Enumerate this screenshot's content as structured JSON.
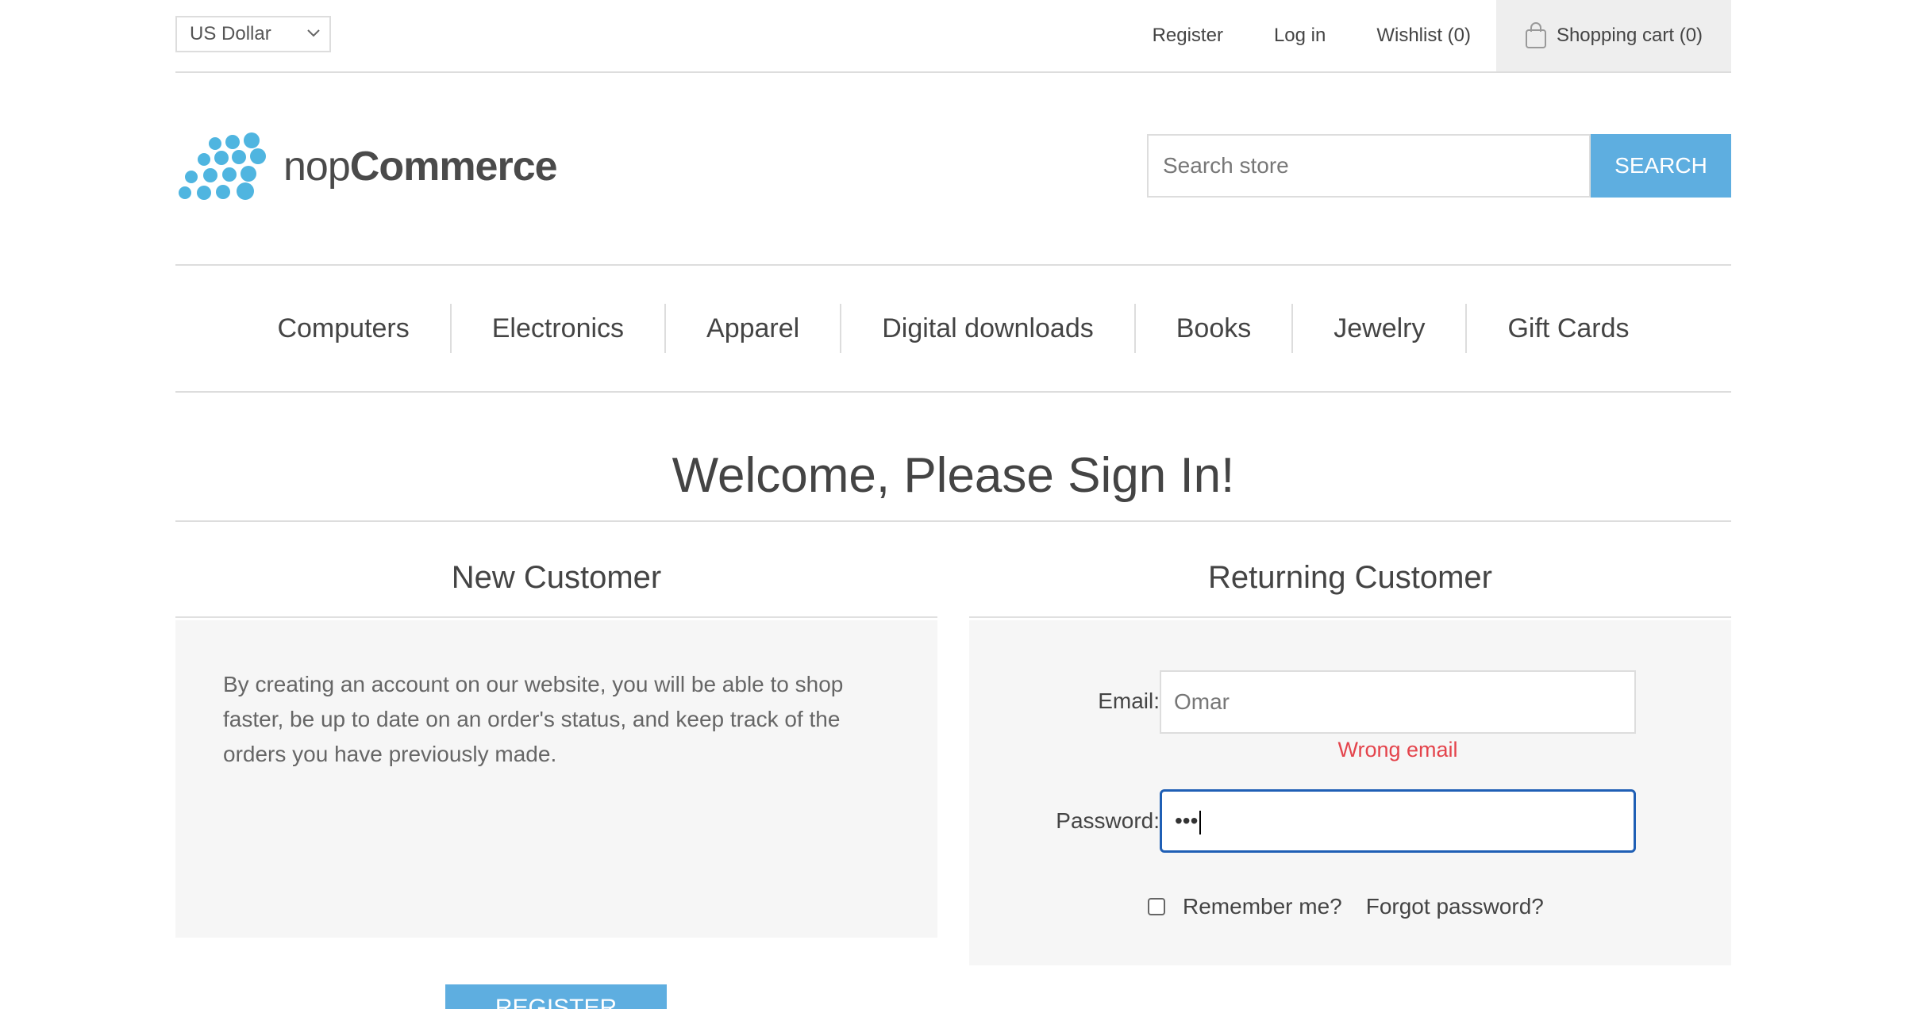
{
  "header": {
    "currency": "US Dollar",
    "links": {
      "register": "Register",
      "login": "Log in",
      "wishlist": "Wishlist (0)",
      "cart": "Shopping cart (0)"
    }
  },
  "logo": {
    "light": "nop",
    "bold": "Commerce"
  },
  "search": {
    "placeholder": "Search store",
    "button": "SEARCH"
  },
  "menu": [
    "Computers",
    "Electronics",
    "Apparel",
    "Digital downloads",
    "Books",
    "Jewelry",
    "Gift Cards"
  ],
  "page": {
    "title": "Welcome, Please Sign In!"
  },
  "new_customer": {
    "title": "New Customer",
    "text": "By creating an account on our website, you will be able to shop faster, be up to date on an order's status, and keep track of the orders you have previously made.",
    "button": "REGISTER"
  },
  "returning_customer": {
    "title": "Returning Customer",
    "email_label": "Email:",
    "email_value": "Omar",
    "email_error": "Wrong email",
    "password_label": "Password:",
    "password_value": "•••",
    "remember_label": "Remember me?",
    "forgot_label": "Forgot password?"
  },
  "colors": {
    "accent": "#5eaee0",
    "error": "#e4444c",
    "focus": "#1f5fb5"
  }
}
